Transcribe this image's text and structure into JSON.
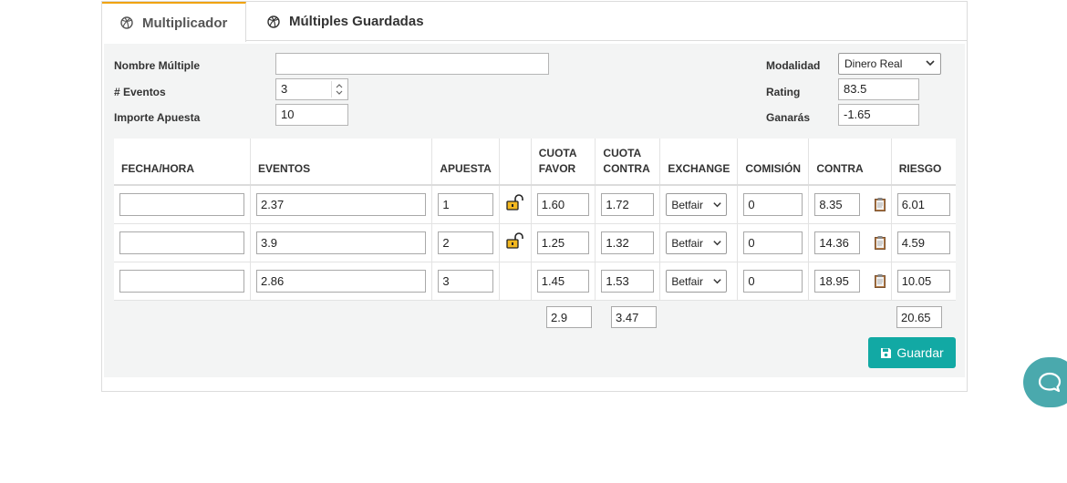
{
  "tabs": [
    {
      "label": "Multiplicador",
      "icon": "dribbble-icon",
      "active": true
    },
    {
      "label": "Múltiples Guardadas",
      "icon": "dribbble-icon",
      "active": false
    }
  ],
  "form": {
    "nombre_label": "Nombre Múltiple",
    "nombre_value": "",
    "eventos_label": "# Eventos",
    "eventos_value": "3",
    "importe_label": "Importe Apuesta",
    "importe_value": "10",
    "modalidad_label": "Modalidad",
    "modalidad_value": "Dinero Real",
    "rating_label": "Rating",
    "rating_value": "83.5",
    "ganaras_label": "Ganarás",
    "ganaras_value": "-1.65"
  },
  "table": {
    "headers": {
      "fecha": "FECHA/HORA",
      "eventos": "EVENTOS",
      "apuesta": "APUESTA",
      "lock": "",
      "cuota_favor_1": "CUOTA",
      "cuota_favor_2": "FAVOR",
      "cuota_contra_1": "CUOTA",
      "cuota_contra_2": "CONTRA",
      "exchange": "EXCHANGE",
      "comision": "COMISIÓN",
      "contra": "CONTRA",
      "riesgo": "RIESGO"
    },
    "rows": [
      {
        "fecha": "",
        "evento": "2.37",
        "apuesta": "1",
        "locked": true,
        "cuota_favor": "1.60",
        "cuota_contra": "1.72",
        "exchange": "Betfair",
        "comision": "0",
        "contra": "8.35",
        "riesgo": "6.01"
      },
      {
        "fecha": "",
        "evento": "3.9",
        "apuesta": "2",
        "locked": true,
        "cuota_favor": "1.25",
        "cuota_contra": "1.32",
        "exchange": "Betfair",
        "comision": "0",
        "contra": "14.36",
        "riesgo": "4.59"
      },
      {
        "fecha": "",
        "evento": "2.86",
        "apuesta": "3",
        "locked": false,
        "cuota_favor": "1.45",
        "cuota_contra": "1.53",
        "exchange": "Betfair",
        "comision": "0",
        "contra": "18.95",
        "riesgo": "10.05"
      }
    ],
    "totals": {
      "cuota_favor": "2.9",
      "cuota_contra": "3.47",
      "riesgo": "20.65"
    }
  },
  "save_button": {
    "label": "Guardar",
    "icon": "floppy-disk-icon"
  },
  "help_widget": {
    "icon": "chat-bubble-icon"
  },
  "colors": {
    "accent": "#12a9a4",
    "tab_active_border": "#f0a30a",
    "help_widget": "#4aa9ad"
  }
}
